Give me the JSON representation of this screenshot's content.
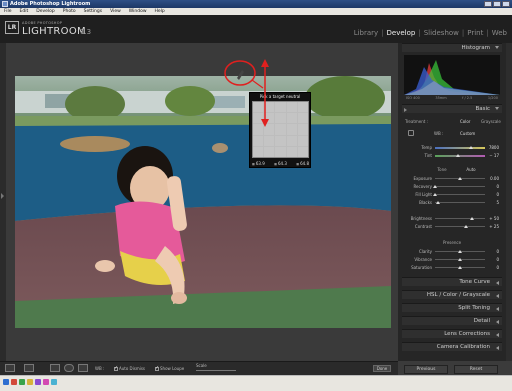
{
  "window": {
    "title": "Adobe Photoshop Lightroom"
  },
  "menu": [
    "File",
    "Edit",
    "Develop",
    "Photo",
    "Settings",
    "View",
    "Window",
    "Help"
  ],
  "identity": {
    "badge": "LR",
    "brand_small": "ADOBE PHOTOSHOP",
    "brand_big": "LIGHTROOM",
    "version": "1.3"
  },
  "modules": [
    {
      "label": "Library",
      "active": false
    },
    {
      "label": "Develop",
      "active": true
    },
    {
      "label": "Slideshow",
      "active": false
    },
    {
      "label": "Print",
      "active": false
    },
    {
      "label": "Web",
      "active": false
    }
  ],
  "loupe": {
    "title": "Pick a target neutral",
    "values": {
      "r": "63.9",
      "g": "64.3",
      "b": "64.8"
    }
  },
  "panel": {
    "histogram": {
      "title": "Histogram",
      "iso": "ISO 400",
      "focal": "35mm",
      "aperture": "f / 2.5",
      "shutter": "1/200"
    },
    "basic": {
      "title": "Basic",
      "treatment_label": "Treatment :",
      "treatment_color": "Color",
      "treatment_gray": "Grayscale",
      "wb_label": "WB :",
      "wb_value": "Custom",
      "temp": {
        "label": "Temp",
        "value": "7800"
      },
      "tint": {
        "label": "Tint",
        "value": "− 17"
      },
      "tone_header": "Tone",
      "auto_label": "Auto",
      "exposure": {
        "label": "Exposure",
        "value": "0.00"
      },
      "recovery": {
        "label": "Recovery",
        "value": "0"
      },
      "fill_light": {
        "label": "Fill Light",
        "value": "0"
      },
      "blacks": {
        "label": "Blacks",
        "value": "5"
      },
      "brightness": {
        "label": "Brightness",
        "value": "+ 50"
      },
      "contrast": {
        "label": "Contrast",
        "value": "+ 25"
      },
      "presence_header": "Presence",
      "clarity": {
        "label": "Clarity",
        "value": "0"
      },
      "vibrance": {
        "label": "Vibrance",
        "value": "0"
      },
      "saturation": {
        "label": "Saturation",
        "value": "0"
      }
    },
    "sections": [
      {
        "title": "Tone Curve"
      },
      {
        "title": "HSL / Color / Grayscale"
      },
      {
        "title": "Split Toning"
      },
      {
        "title": "Detail"
      },
      {
        "title": "Lens Corrections"
      },
      {
        "title": "Camera Calibration"
      }
    ],
    "previous_label": "Previous",
    "reset_label": "Reset"
  },
  "toolbar": {
    "wb_label": "WB :",
    "auto_dismiss": "Auto Dismiss",
    "show_loupe": "Show Loupe",
    "scale_label": "Scale",
    "done_label": "Done"
  },
  "colors": {
    "annotation": "#e0201f",
    "panel_bg": "#262626",
    "photo_court": "#1f5f8a"
  }
}
